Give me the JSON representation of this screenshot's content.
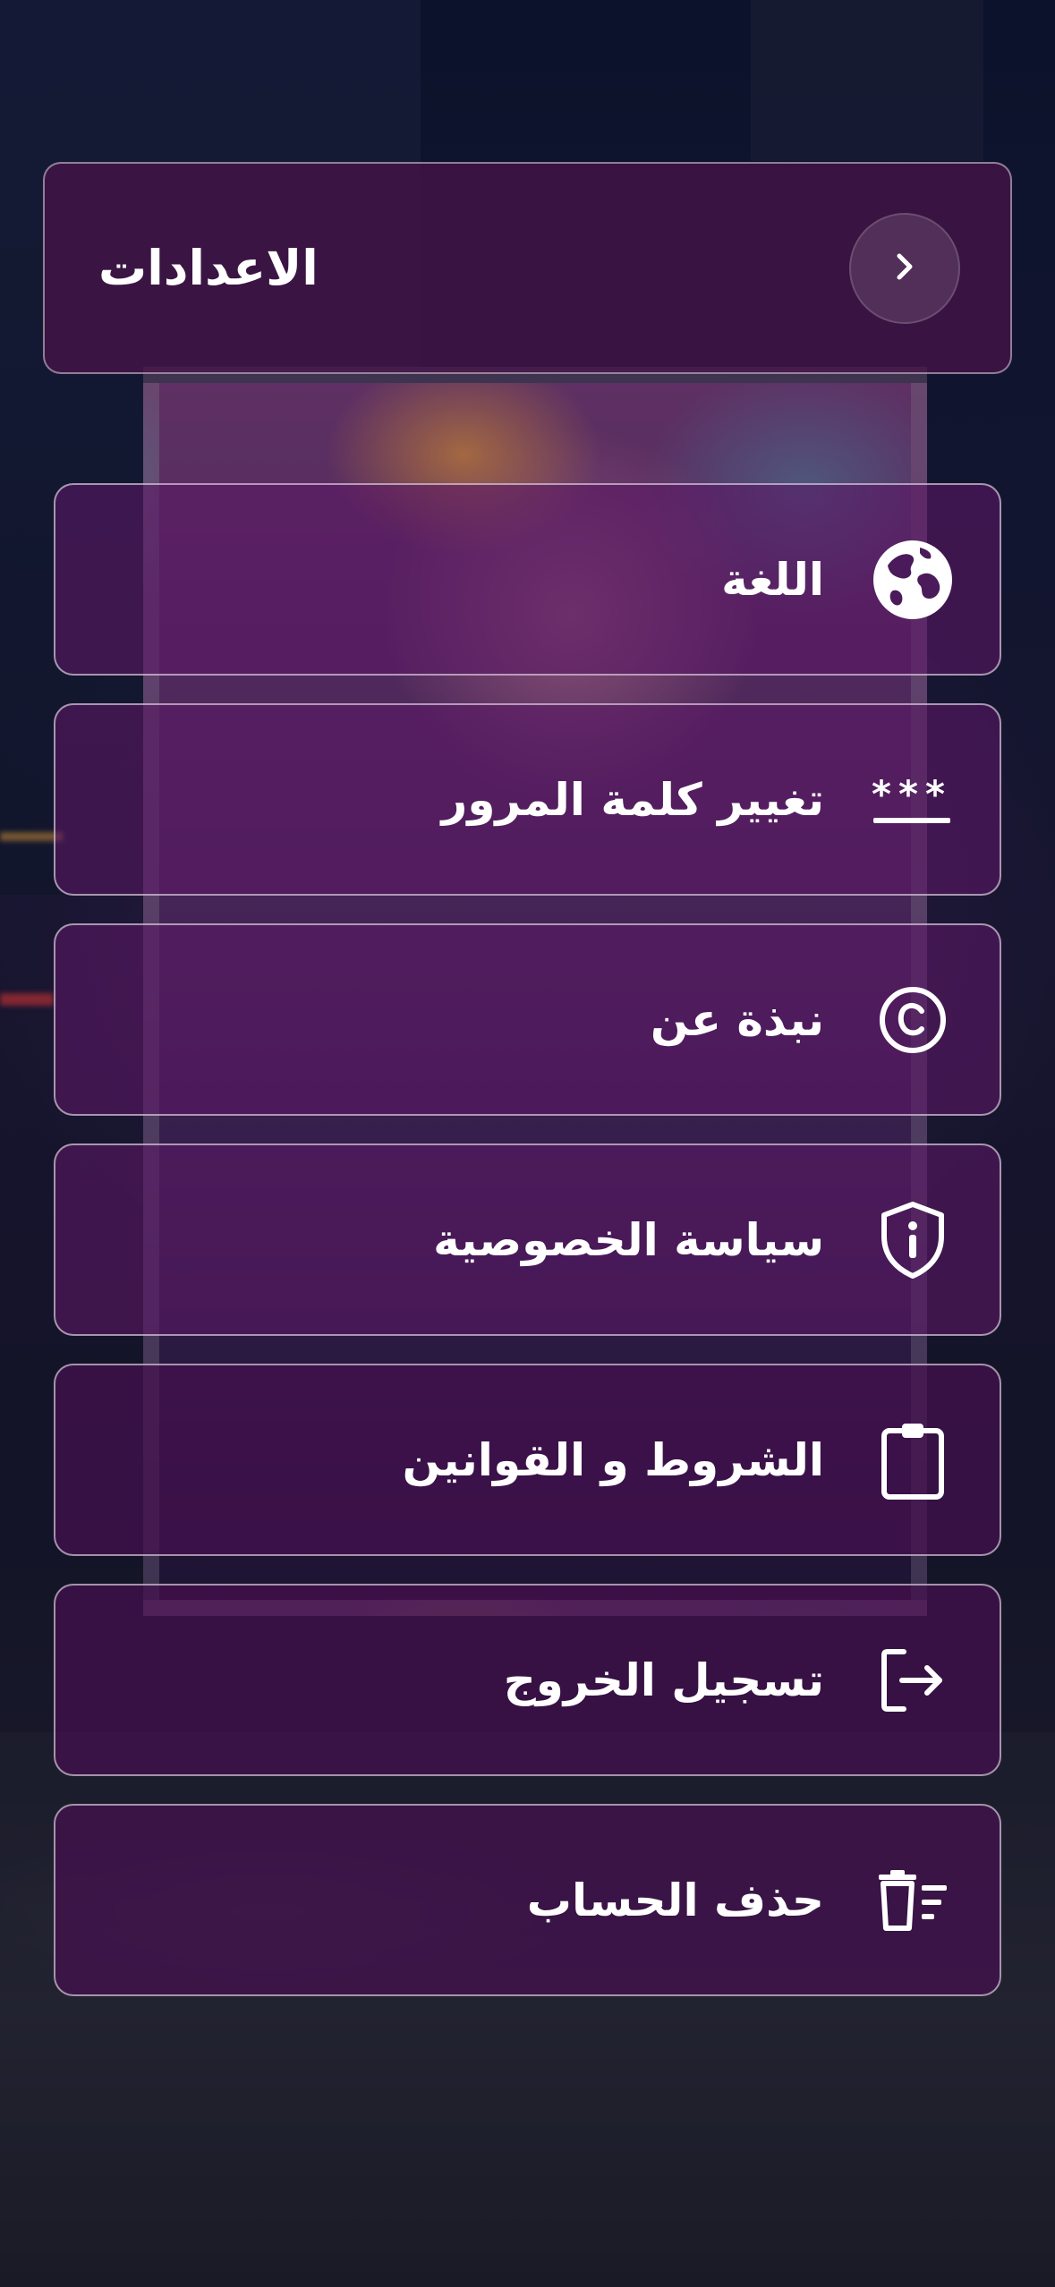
{
  "header": {
    "title": "الاعدادات",
    "back_icon": "chevron-right-icon"
  },
  "menu": {
    "items": [
      {
        "id": "language",
        "label": "اللغة",
        "icon": "globe-icon"
      },
      {
        "id": "change-password",
        "label": "تغيير كلمة المرور",
        "icon": "password-icon"
      },
      {
        "id": "about",
        "label": "نبذة عن",
        "icon": "copyright-icon"
      },
      {
        "id": "privacy-policy",
        "label": "سياسة الخصوصية",
        "icon": "shield-info-icon"
      },
      {
        "id": "terms",
        "label": "الشروط و القوانين",
        "icon": "clipboard-icon"
      },
      {
        "id": "logout",
        "label": "تسجيل الخروج",
        "icon": "logout-icon"
      },
      {
        "id": "delete-account",
        "label": "حذف الحساب",
        "icon": "delete-account-icon"
      }
    ]
  },
  "colors": {
    "card_background": "#4a144a",
    "card_border": "#ffffff",
    "text": "#ffffff"
  }
}
